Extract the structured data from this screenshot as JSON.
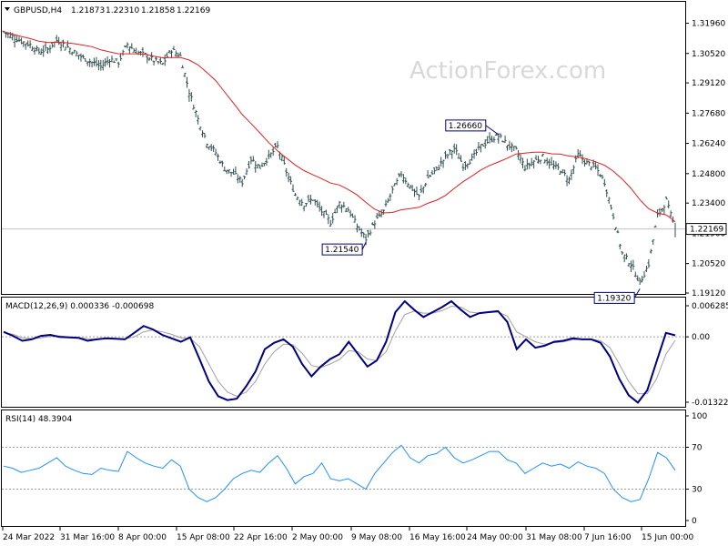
{
  "header": {
    "symbol": "GBPUSD,H4",
    "open": "1.21873",
    "high": "1.22310",
    "low": "1.21858",
    "close": "1.22169"
  },
  "watermark": "ActionForex.com",
  "colors": {
    "price_bars": "#2f4f4f",
    "ma_line": "#e02020",
    "macd_line": "#000080",
    "signal_line": "#a0a0a0",
    "rsi_line": "#1e90ff",
    "grid_dotted": "#a0a0a0"
  },
  "chart_data": [
    {
      "type": "ohlc",
      "title": "GBPUSD,H4 1.21873 1.22310 1.21858 1.22169",
      "series": [
        {
          "values": [
            1.3156,
            1.3132,
            1.311,
            1.3093,
            1.306,
            1.3072,
            1.3115,
            1.309,
            1.3058,
            1.3031,
            1.301,
            1.299,
            1.3025,
            1.301,
            1.3096,
            1.306,
            1.3045,
            1.3018,
            1.3002,
            1.307,
            1.304,
            1.287,
            1.274,
            1.263,
            1.258,
            1.2505,
            1.248,
            1.244,
            1.255,
            1.251,
            1.256,
            1.261,
            1.249,
            1.238,
            1.2336,
            1.236,
            1.23,
            1.225,
            1.234,
            1.231,
            1.223,
            1.217,
            1.225,
            1.23,
            1.24,
            1.248,
            1.242,
            1.237,
            1.246,
            1.25,
            1.256,
            1.26,
            1.252,
            1.255,
            1.261,
            1.264,
            1.266,
            1.262,
            1.259,
            1.251,
            1.254,
            1.256,
            1.252,
            1.25,
            1.245,
            1.257,
            1.253,
            1.251,
            1.244,
            1.228,
            1.21,
            1.205,
            1.196,
            1.205,
            1.228,
            1.235,
            1.2217
          ]
        },
        {
          "name": "",
          "values": []
        }
      ],
      "price_labels": [
        "1.26660",
        "1.21540",
        "1.19320"
      ],
      "current_price_label": "1.22169",
      "ylim": [
        1.1912,
        1.3196
      ],
      "yticks": [
        "1.31960",
        "1.30520",
        "1.29120",
        "1.27680",
        "1.26240",
        "1.24800",
        "1.23400",
        "1.21960",
        "1.20520",
        "1.19120"
      ]
    },
    {
      "type": "line",
      "title": "MACD(12,26,9) 0.000336 -0.000698",
      "series": [
        {
          "values": [
            0.001,
            0.0002,
            -0.0008,
            -0.0005,
            0.0002,
            0.0004,
            0.0,
            -0.0001,
            -0.0002,
            -0.0008,
            -0.0005,
            -0.0003,
            -0.0004,
            -0.0005,
            0.0008,
            0.0022,
            0.0015,
            0.0004,
            -0.0003,
            -0.001,
            -0.0001,
            -0.0045,
            -0.009,
            -0.012,
            -0.0128,
            -0.0125,
            -0.01,
            -0.007,
            -0.0025,
            -0.0012,
            -0.0005,
            -0.002,
            -0.0055,
            -0.008,
            -0.006,
            -0.0045,
            -0.0035,
            -0.001,
            -0.0035,
            -0.006,
            -0.0048,
            -0.001,
            0.005,
            0.0072,
            0.0055,
            0.004,
            0.005,
            0.006,
            0.0072,
            0.0055,
            0.004,
            0.0048,
            0.005,
            0.0052,
            0.003,
            -0.0025,
            -0.0005,
            -0.0022,
            -0.0018,
            -0.001,
            -0.0008,
            -0.0003,
            -0.0005,
            -0.0005,
            -0.0012,
            -0.004,
            -0.0085,
            -0.0118,
            -0.0133,
            -0.0108,
            -0.005,
            0.0008,
            0.0003
          ]
        },
        {
          "values": [
            0.0008,
            0.0005,
            -0.0002,
            -0.0004,
            -0.0002,
            0.0001,
            0.0002,
            0.0,
            -0.0001,
            -0.0004,
            -0.0005,
            -0.0004,
            -0.0004,
            -0.0004,
            0.0,
            0.001,
            0.0014,
            0.001,
            0.0005,
            -0.0002,
            -0.0003,
            -0.002,
            -0.0055,
            -0.009,
            -0.0112,
            -0.012,
            -0.0112,
            -0.009,
            -0.0055,
            -0.003,
            -0.0015,
            -0.0016,
            -0.0033,
            -0.0058,
            -0.0062,
            -0.0055,
            -0.0046,
            -0.0028,
            -0.003,
            -0.0045,
            -0.0048,
            -0.003,
            0.0012,
            0.0045,
            0.0052,
            0.0048,
            0.0048,
            0.0053,
            0.0062,
            0.006,
            0.005,
            0.0048,
            0.0049,
            0.005,
            0.0042,
            0.001,
            0.0,
            -0.001,
            -0.0015,
            -0.0012,
            -0.001,
            -0.0006,
            -0.0005,
            -0.0005,
            -0.0008,
            -0.0022,
            -0.0055,
            -0.009,
            -0.0115,
            -0.0115,
            -0.0085,
            -0.0035,
            -0.0007
          ]
        }
      ],
      "ylim": [
        -0.013223,
        0.006285
      ],
      "yticks": [
        "0.006285",
        "0.00",
        "-0.013223"
      ]
    },
    {
      "type": "line",
      "title": "RSI(14) 48.3904",
      "series": [
        {
          "values": [
            52,
            50,
            46,
            48,
            50,
            55,
            60,
            52,
            48,
            45,
            44,
            50,
            48,
            47,
            66,
            60,
            55,
            52,
            50,
            58,
            52,
            30,
            22,
            18,
            22,
            30,
            40,
            45,
            48,
            46,
            55,
            62,
            50,
            35,
            42,
            45,
            55,
            40,
            38,
            40,
            35,
            30,
            45,
            55,
            65,
            72,
            60,
            55,
            62,
            64,
            70,
            60,
            55,
            58,
            62,
            66,
            66,
            58,
            55,
            45,
            50,
            55,
            52,
            54,
            50,
            56,
            52,
            50,
            45,
            30,
            22,
            18,
            20,
            40,
            65,
            60,
            48
          ]
        }
      ],
      "ylim": [
        0,
        100
      ],
      "yticks": [
        "100",
        "70",
        "30",
        "0"
      ],
      "levels": [
        70,
        30
      ]
    }
  ],
  "x_axis": {
    "labels": [
      "24 Mar 2022",
      "31 Mar 16:00",
      "8 Apr 00:00",
      "15 Apr 08:00",
      "22 Apr 16:00",
      "2 May 00:00",
      "9 May 08:00",
      "16 May 16:00",
      "24 May 00:00",
      "31 May 08:00",
      "7 Jun 16:00",
      "15 Jun 00:00"
    ]
  }
}
